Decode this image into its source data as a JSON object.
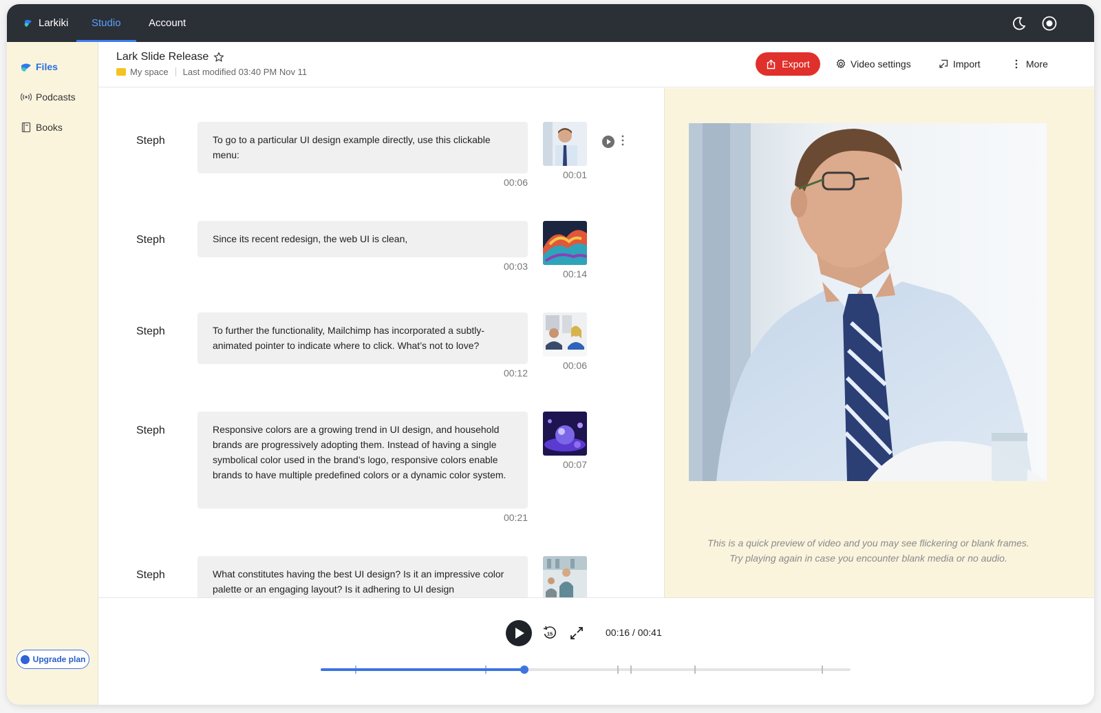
{
  "topbar": {
    "brand": "Larkiki",
    "tabs": [
      {
        "label": "Studio",
        "active": true
      },
      {
        "label": "Account",
        "active": false
      }
    ],
    "icons": [
      "moon-icon",
      "record-icon"
    ]
  },
  "sidebar": {
    "items": [
      {
        "label": "Files",
        "icon": "files-icon",
        "active": true
      },
      {
        "label": "Podcasts",
        "icon": "podcast-icon",
        "active": false
      },
      {
        "label": "Books",
        "icon": "book-icon",
        "active": false
      }
    ],
    "upgrade_label": "Upgrade plan"
  },
  "header": {
    "title": "Lark Slide Release",
    "space": "My space",
    "last_modified": "Last modified 03:40 PM Nov 11",
    "export_label": "Export",
    "video_settings_label": "Video settings",
    "import_label": "Import",
    "more_label": "More"
  },
  "transcript": [
    {
      "speaker": "Steph",
      "text": "To go to a particular UI design example directly, use this clickable menu:",
      "duration": "00:06",
      "thumb_time": "00:01",
      "thumb": "man-office"
    },
    {
      "speaker": "Steph",
      "text": "Since its recent redesign, the web UI is clean,",
      "duration": "00:03",
      "thumb_time": "00:14",
      "thumb": "abstract-color"
    },
    {
      "speaker": "Steph",
      "text": "To further the functionality, Mailchimp has incorporated a subtly-animated pointer to indicate where to click. What’s not to love?",
      "duration": "00:12",
      "thumb_time": "00:06",
      "thumb": "meeting"
    },
    {
      "speaker": "Steph",
      "text": "Responsive colors are a growing trend in UI design, and household brands are progressively adopting them. Instead of having a single symbolical color used in the brand’s logo, responsive colors enable brands to have multiple predefined colors or a dynamic color system.",
      "duration": "00:21",
      "thumb_time": "00:07",
      "thumb": "purple-sphere"
    },
    {
      "speaker": "Steph",
      "text": "What constitutes having the best UI design? Is it an impressive color palette or an engaging layout? Is it adhering to UI design",
      "duration": "",
      "thumb_time": "",
      "thumb": "office-team"
    }
  ],
  "preview": {
    "note_line1": "This is a quick preview of video and you may see flickering or blank frames.",
    "note_line2": "Try playing again in case you encounter blank media or no audio."
  },
  "player": {
    "current": "00:16",
    "total": "00:41",
    "readout": "00:16 / 00:41",
    "progress": 0.385,
    "markers": [
      0.065,
      0.31,
      0.56,
      0.585,
      0.705,
      0.945
    ],
    "icons": [
      "play-icon",
      "rewind-15-icon",
      "fullscreen-icon"
    ]
  },
  "colors": {
    "topbar": "#2b2f36",
    "accent": "#3e74e0",
    "export": "#e0302b",
    "sidebar": "#fbf4dd"
  }
}
